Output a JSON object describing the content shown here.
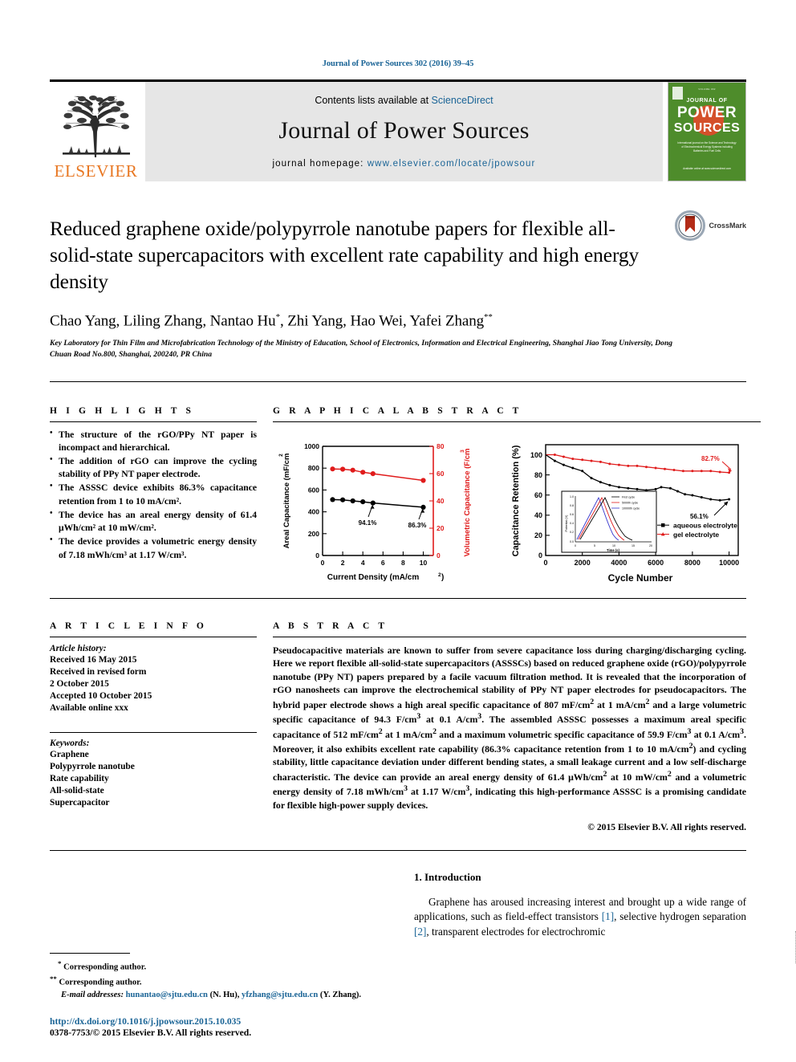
{
  "header": {
    "running_head": "Journal of Power Sources 302 (2016) 39–45",
    "contents_prefix": "Contents lists available at ",
    "contents_link": "ScienceDirect",
    "journal_name": "Journal of Power Sources",
    "homepage_prefix": "journal homepage: ",
    "homepage_url": "www.elsevier.com/locate/jpowsour",
    "publisher_wordmark": "ELSEVIER",
    "cover": {
      "top_line": "VOLUME 302",
      "line1": "JOURNAL OF",
      "line2": "POWER",
      "line3": "SOURCES",
      "blurb": "International journal on the Science and Technology of Electrochemical Energy Systems including Batteries and Fuel Cells",
      "foot": "Available online at www.sciencedirect.com"
    },
    "crossmark_label": "CrossMark"
  },
  "article": {
    "title": "Reduced graphene oxide/polypyrrole nanotube papers for flexible all-solid-state supercapacitors with excellent rate capability and high energy density",
    "authors": "Chao Yang, Liling Zhang, Nantao Hu",
    "authors_mid": ", Zhi Yang, Hao Wei, Yafei Zhang",
    "author_mark_1": "*",
    "author_mark_2": "**",
    "affiliation": "Key Laboratory for Thin Film and Microfabrication Technology of the Ministry of Education, School of Electronics, Information and Electrical Engineering, Shanghai Jiao Tong University, Dong Chuan Road No.800, Shanghai, 200240, PR China"
  },
  "highlights": {
    "heading": "H I G H L I G H T S",
    "items": [
      "The structure of the rGO/PPy NT paper is incompact and hierarchical.",
      "The addition of rGO can improve the cycling stability of PPy NT paper electrode.",
      "The ASSSC device exhibits 86.3% capacitance retention from 1 to 10 mA/cm².",
      "The device has an areal energy density of 61.4 μWh/cm² at 10 mW/cm².",
      "The device provides a volumetric energy density of 7.18 mWh/cm³ at 1.17 W/cm³."
    ]
  },
  "graphical_abstract": {
    "heading": "G R A P H I C A L   A B S T R A C T"
  },
  "chart_data": [
    {
      "type": "line",
      "title": "",
      "xlabel": "Current Density (mA/cm2)",
      "ylabel": "Areal Capacitance (mF/cm2)",
      "ylabel_right": "Volumetric Capacitance (F/cm3)",
      "xlim": [
        0,
        11
      ],
      "xticks": [
        0,
        2,
        4,
        6,
        8,
        10
      ],
      "ylim": [
        0,
        1000
      ],
      "yticks": [
        0,
        200,
        400,
        600,
        800,
        1000
      ],
      "ylim_right": [
        0,
        80
      ],
      "yticks_right": [
        0,
        20,
        40,
        60,
        80
      ],
      "x": [
        1,
        2,
        3,
        4,
        5,
        10
      ],
      "series": [
        {
          "name": "Areal Capacitance",
          "color": "#000000",
          "axis": "left",
          "values": [
            512,
            510,
            500,
            492,
            481,
            442
          ]
        },
        {
          "name": "Volumetric Capacitance",
          "color": "#e01b1b",
          "axis": "right",
          "values": [
            59.9,
            59.7,
            59.0,
            57.5,
            56.4,
            51.5
          ]
        }
      ],
      "annotations": [
        {
          "text": "94.1%",
          "x": 5,
          "y": 481
        },
        {
          "text": "86.3%",
          "x": 10,
          "y": 442
        }
      ],
      "grid": false,
      "legend": "none"
    },
    {
      "type": "line",
      "title": "",
      "xlabel": "Cycle Number",
      "ylabel": "Capacitance Retention (%)",
      "xlim": [
        0,
        10000
      ],
      "xticks": [
        0,
        2000,
        4000,
        6000,
        8000,
        10000
      ],
      "ylim": [
        0,
        110
      ],
      "yticks": [
        0,
        20,
        40,
        60,
        80,
        100
      ],
      "series": [
        {
          "name": "aqueous electrolyte",
          "color": "#000000",
          "x": [
            0,
            500,
            1000,
            1500,
            2000,
            2500,
            3000,
            3500,
            4000,
            4500,
            5000,
            5500,
            6000,
            6300,
            6800,
            7200,
            7600,
            8000,
            8500,
            9000,
            9500,
            10000
          ],
          "values": [
            100,
            94,
            90,
            87,
            84,
            77,
            73,
            70,
            68,
            67,
            66,
            65,
            66,
            68,
            67,
            64,
            61,
            60,
            58,
            56,
            55,
            56.1
          ]
        },
        {
          "name": "gel electrolyte",
          "color": "#e01b1b",
          "x": [
            0,
            500,
            1000,
            1500,
            2000,
            2500,
            3000,
            3500,
            4000,
            4500,
            5000,
            5500,
            6000,
            6500,
            7000,
            7500,
            8000,
            8500,
            9000,
            9500,
            10000
          ],
          "values": [
            100,
            100,
            98,
            96,
            95,
            94,
            93,
            91,
            90,
            89,
            89,
            88,
            87,
            86,
            85,
            84,
            84,
            84,
            84,
            83,
            82.7
          ]
        }
      ],
      "annotations": [
        {
          "text": "82.7%",
          "x": 9200,
          "y": 90,
          "color": "#e01b1b"
        },
        {
          "text": "56.1%",
          "x": 8600,
          "y": 42,
          "color": "#000000"
        }
      ],
      "legend": "inside-bottom-right",
      "legend_entries": [
        "aqueous electrolyte",
        "gel electrolyte"
      ],
      "inset": {
        "type": "line",
        "xlabel": "Time (s)",
        "ylabel": "Potential (V)",
        "xticks": [
          0,
          5,
          10,
          15,
          20
        ],
        "yticks": [
          0.0,
          0.2,
          0.4,
          0.6,
          0.8,
          1.0
        ],
        "legend_entries": [
          "First cycle",
          "5000th cycle",
          "10000th cycle"
        ],
        "colors": [
          "#000000",
          "#e01b1b",
          "#3333cc"
        ]
      }
    }
  ],
  "article_info": {
    "heading": "A R T I C L E   I N F O",
    "history_label": "Article history:",
    "history": [
      "Received 16 May 2015",
      "Received in revised form",
      "2 October 2015",
      "Accepted 10 October 2015",
      "Available online xxx"
    ],
    "keywords_label": "Keywords:",
    "keywords": [
      "Graphene",
      "Polypyrrole nanotube",
      "Rate capability",
      "All-solid-state",
      "Supercapacitor"
    ]
  },
  "abstract": {
    "heading": "A B S T R A C T",
    "paragraph_1": "Pseudocapacitive materials are known to suffer from severe capacitance loss during charging/discharging cycling. Here we report flexible all-solid-state supercapacitors (ASSSCs) based on reduced graphene oxide (rGO)/polypyrrole nanotube (PPy NT) papers prepared by a facile vacuum filtration method. It is revealed that the incorporation of rGO nanosheets can improve the electrochemical stability of PPy NT paper electrodes for pseudocapacitors. The hybrid paper electrode shows a high areal specific capacitance of 807 mF/cm",
    "p1_b": " at 1 mA/cm",
    "p1_c": " and a large volumetric specific capacitance of 94.3 F/cm",
    "p1_d": " at 0.1 A/cm",
    "p1_e": ". The assembled ASSSC possesses a maximum areal specific capacitance of 512 mF/cm",
    "p1_f": " at 1 mA/cm",
    "p1_g": " and a maximum volumetric specific capacitance of 59.9 F/cm",
    "p1_h": " at 0.1 A/cm",
    "p1_i": ". Moreover, it also exhibits excellent rate capability (86.3% capacitance retention from 1 to 10 mA/cm",
    "p1_j": ") and cycling stability, little capacitance deviation under different bending states, a small leakage current and a low self-discharge characteristic. The device can provide an areal energy density of 61.4 μWh/cm",
    "p1_k": " at 10 mW/cm",
    "p1_l": " and a volumetric energy density of 7.18 mWh/cm",
    "p1_m": " at 1.17 W/cm",
    "p1_n": ", indicating this high-performance ASSSC is a promising candidate for flexible high-power supply devices.",
    "copyright": "© 2015 Elsevier B.V. All rights reserved."
  },
  "introduction": {
    "number_title": "1. Introduction",
    "text_a": "Graphene has aroused increasing interest and brought up a wide range of applications, such as field-effect transistors ",
    "ref_1": "[1]",
    "text_b": ", selective hydrogen separation ",
    "ref_2": "[2]",
    "text_c": ", transparent electrodes for electrochromic"
  },
  "footnotes": {
    "line_1_mark": "*",
    "line_1": "Corresponding author.",
    "line_2_mark": "**",
    "line_2": "Corresponding author.",
    "email_label": "E-mail addresses:",
    "email_1": "hunantao@sjtu.edu.cn",
    "email_1_who": "(N. Hu),",
    "email_2": "yfzhang@sjtu.edu.cn",
    "email_2_who": "(Y. Zhang).",
    "doi": "http://dx.doi.org/10.1016/j.jpowsour.2015.10.035",
    "issn": "0378-7753/© 2015 Elsevier B.V. All rights reserved."
  },
  "colors": {
    "link": "#1a6496",
    "elsevier_orange": "#e87722",
    "band_gray": "#e6e6e6",
    "chart_red": "#e01b1b",
    "chart_black": "#000000",
    "cover_green": "#4e8c2b"
  }
}
